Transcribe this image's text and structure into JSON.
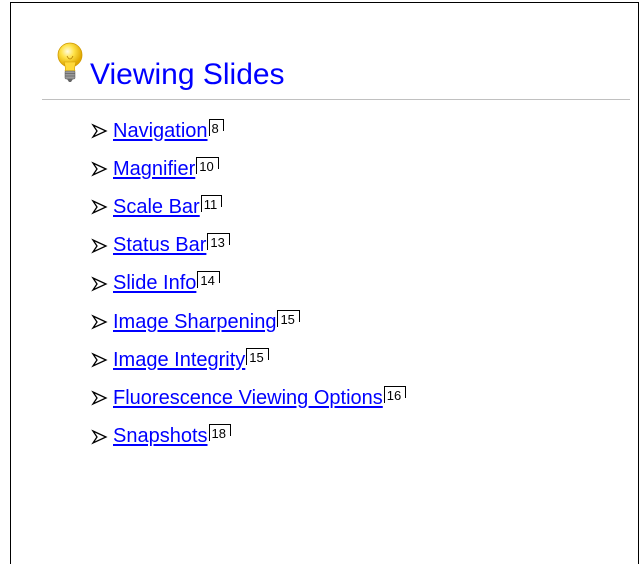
{
  "heading": {
    "title": "Viewing Slides",
    "icon": "lightbulb-icon"
  },
  "topics": [
    {
      "label": "Navigation",
      "page": "8"
    },
    {
      "label": "Magnifier",
      "page": "10"
    },
    {
      "label": "Scale Bar",
      "page": "11"
    },
    {
      "label": "Status Bar",
      "page": "13"
    },
    {
      "label": "Slide Info",
      "page": "14"
    },
    {
      "label": "Image Sharpening",
      "page": "15"
    },
    {
      "label": "Image Integrity",
      "page": "15"
    },
    {
      "label": "Fluorescence Viewing Options",
      "page": "16"
    },
    {
      "label": "Snapshots",
      "page": "18"
    }
  ],
  "colors": {
    "link": "#0000ff",
    "title": "#0000ff",
    "rule": "#c0c0c0",
    "bulb": "#f5c400"
  }
}
